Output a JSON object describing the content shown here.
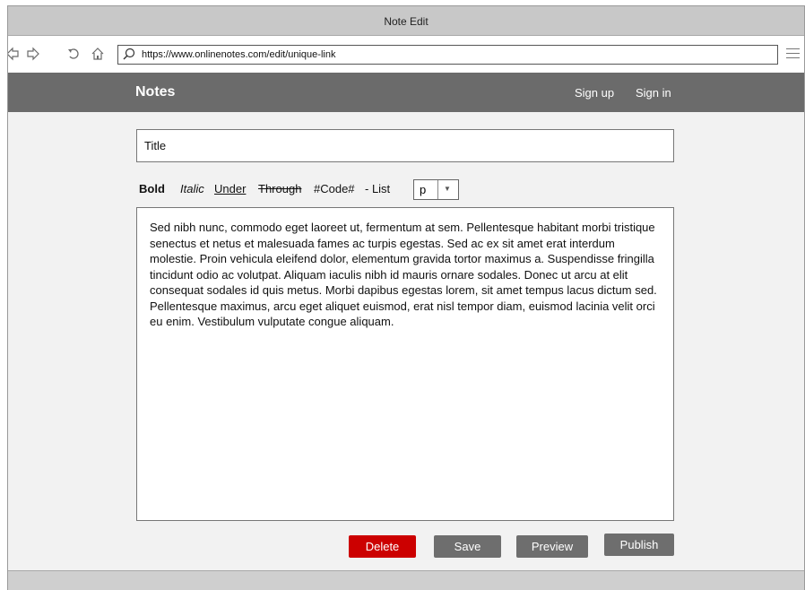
{
  "window": {
    "title": "Note Edit"
  },
  "browser": {
    "url": "https://www.onlinenotes.com/edit/unique-link",
    "icons": [
      "back-icon",
      "forward-icon",
      "refresh-icon",
      "home-icon",
      "search-icon",
      "menu-icon"
    ]
  },
  "header": {
    "brand": "Notes",
    "links": {
      "signup": "Sign up",
      "signin": "Sign in"
    },
    "background": "#6b6b6b"
  },
  "editor": {
    "title_placeholder": "Title",
    "toolbar": {
      "bold": "Bold",
      "italic": "Italic",
      "under": "Under",
      "through": "Through",
      "code": "#Code#",
      "list": "- List",
      "block_select": "p"
    },
    "body": "Sed nibh nunc, commodo eget laoreet ut, fermentum at sem. Pellentesque habitant morbi tristique senectus et netus et malesuada fames ac turpis egestas. Sed ac ex sit amet erat interdum molestie. Proin vehicula eleifend dolor, elementum gravida tortor maximus a. Suspendisse fringilla tincidunt odio ac volutpat. Aliquam iaculis nibh id mauris ornare sodales. Donec ut arcu at elit consequat sodales id quis metus. Morbi dapibus egestas lorem, sit amet tempus lacus dictum sed. Pellentesque maximus, arcu eget aliquet euismod, erat nisl tempor diam, euismod lacinia velit orci eu enim. Vestibulum vulputate congue aliquam."
  },
  "actions": {
    "delete": "Delete",
    "save": "Save",
    "preview": "Preview",
    "publish": "Publish",
    "delete_color": "#cc0000",
    "button_color": "#6e6e6e"
  }
}
